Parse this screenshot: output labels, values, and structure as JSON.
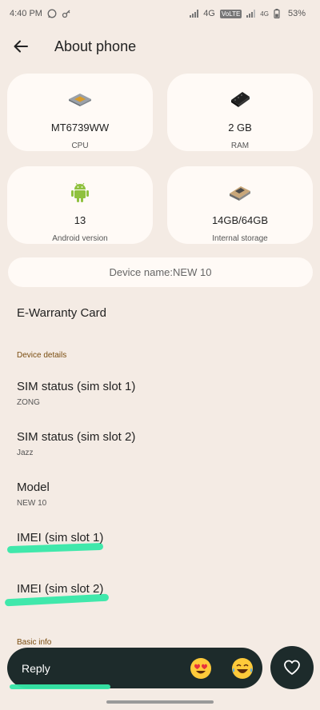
{
  "status_bar": {
    "time": "4:40 PM",
    "network_1": "4G",
    "network_badge": "VoLTE",
    "network_2": "4G",
    "battery": "53%"
  },
  "header": {
    "title": "About phone"
  },
  "tiles": [
    {
      "value": "MT6739WW",
      "label": "CPU",
      "icon": "chip-icon"
    },
    {
      "value": "2 GB",
      "label": "RAM",
      "icon": "ram-icon"
    },
    {
      "value": "13",
      "label": "Android version",
      "icon": "android-icon"
    },
    {
      "value": "14GB/64GB",
      "label": "Internal storage",
      "icon": "storage-icon"
    }
  ],
  "device_name": "Device name:NEW 10",
  "e_warranty": "E-Warranty Card",
  "device_details_header": "Device details",
  "rows": [
    {
      "title": "SIM status (sim slot 1)",
      "sub": "ZONG"
    },
    {
      "title": "SIM status (sim slot 2)",
      "sub": "Jazz"
    },
    {
      "title": "Model",
      "sub": "NEW 10"
    },
    {
      "title": "IMEI (sim slot 1)",
      "sub": ""
    },
    {
      "title": "IMEI (sim slot 2)",
      "sub": ""
    }
  ],
  "basic_info_header": "Basic info",
  "reply": {
    "label": "Reply",
    "emoji_1": "heart-eyes-emoji",
    "emoji_2": "tears-of-joy-emoji",
    "heart": "heart-icon"
  },
  "colors": {
    "background": "#f4ebe4",
    "card": "#fffaf6",
    "section_header": "#7a4d10",
    "reply_bar": "#1d2b2b",
    "highlight": "#36e8a8"
  }
}
